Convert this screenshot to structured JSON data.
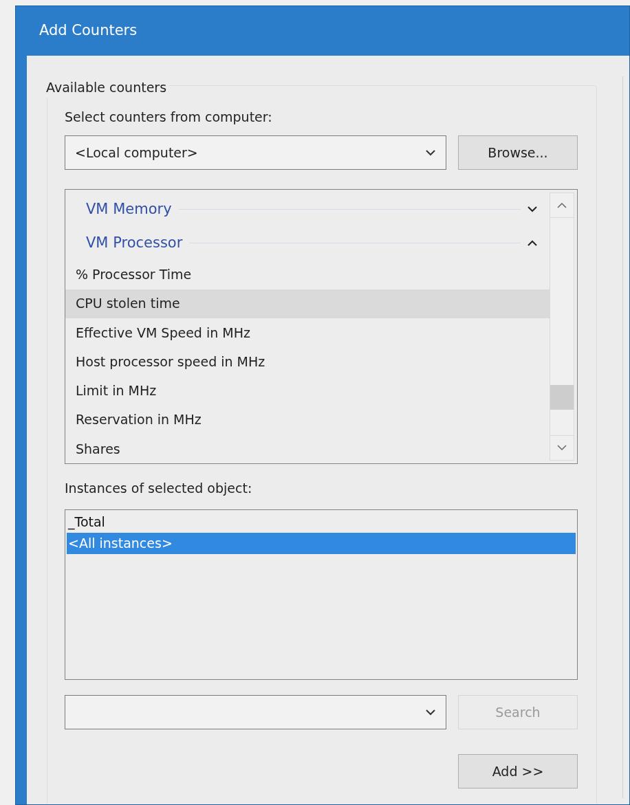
{
  "window": {
    "title": "Add Counters"
  },
  "group": {
    "title": "Available counters"
  },
  "computer": {
    "label": "Select counters from computer:",
    "value": "<Local computer>",
    "browse": "Browse..."
  },
  "counters": [
    {
      "kind": "category",
      "label": "VM Memory",
      "expanded": false
    },
    {
      "kind": "category",
      "label": "VM Processor",
      "expanded": true
    },
    {
      "kind": "counter",
      "label": "% Processor Time",
      "selected": false
    },
    {
      "kind": "counter",
      "label": "CPU stolen time",
      "selected": true
    },
    {
      "kind": "counter",
      "label": "Effective VM Speed in MHz",
      "selected": false
    },
    {
      "kind": "counter",
      "label": "Host processor speed in MHz",
      "selected": false
    },
    {
      "kind": "counter",
      "label": "Limit in MHz",
      "selected": false
    },
    {
      "kind": "counter",
      "label": "Reservation in MHz",
      "selected": false
    },
    {
      "kind": "counter",
      "label": "Shares",
      "selected": false
    }
  ],
  "instances": {
    "label": "Instances of selected object:",
    "items": [
      {
        "label": "_Total",
        "selected": false
      },
      {
        "label": "<All instances>",
        "selected": true
      }
    ]
  },
  "search": {
    "button": "Search",
    "disabled": true
  },
  "add_button": "Add >>"
}
